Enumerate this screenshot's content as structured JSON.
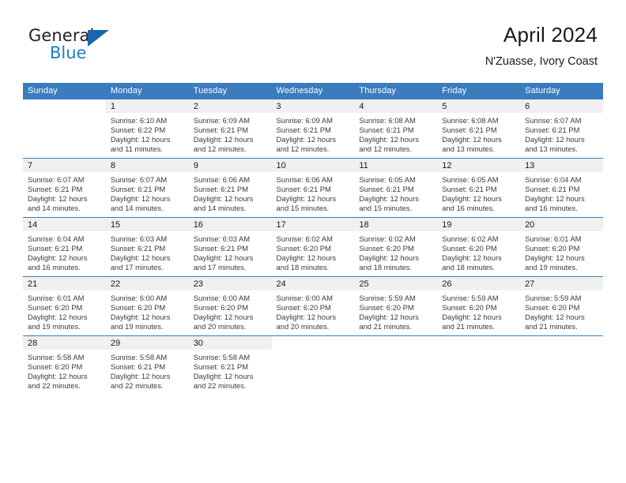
{
  "logo": {
    "word1": "General",
    "word2": "Blue",
    "triangle_color": "#1767ad",
    "blue_color": "#1b7dc4"
  },
  "title": {
    "month_year": "April 2024",
    "location": "N'Zuasse, Ivory Coast"
  },
  "theme": {
    "header_blue": "#3a7cbe",
    "daynum_gray": "#f0f0f0",
    "text": "#3b3b3b"
  },
  "calendar": {
    "weekday_headers": [
      "Sunday",
      "Monday",
      "Tuesday",
      "Wednesday",
      "Thursday",
      "Friday",
      "Saturday"
    ],
    "weeks": [
      [
        {
          "day": "",
          "sunrise": "",
          "sunset": "",
          "daylight1": "",
          "daylight2": "",
          "blank": true
        },
        {
          "day": "1",
          "sunrise": "Sunrise: 6:10 AM",
          "sunset": "Sunset: 6:22 PM",
          "daylight1": "Daylight: 12 hours",
          "daylight2": "and 11 minutes."
        },
        {
          "day": "2",
          "sunrise": "Sunrise: 6:09 AM",
          "sunset": "Sunset: 6:21 PM",
          "daylight1": "Daylight: 12 hours",
          "daylight2": "and 12 minutes."
        },
        {
          "day": "3",
          "sunrise": "Sunrise: 6:09 AM",
          "sunset": "Sunset: 6:21 PM",
          "daylight1": "Daylight: 12 hours",
          "daylight2": "and 12 minutes."
        },
        {
          "day": "4",
          "sunrise": "Sunrise: 6:08 AM",
          "sunset": "Sunset: 6:21 PM",
          "daylight1": "Daylight: 12 hours",
          "daylight2": "and 12 minutes."
        },
        {
          "day": "5",
          "sunrise": "Sunrise: 6:08 AM",
          "sunset": "Sunset: 6:21 PM",
          "daylight1": "Daylight: 12 hours",
          "daylight2": "and 13 minutes."
        },
        {
          "day": "6",
          "sunrise": "Sunrise: 6:07 AM",
          "sunset": "Sunset: 6:21 PM",
          "daylight1": "Daylight: 12 hours",
          "daylight2": "and 13 minutes."
        }
      ],
      [
        {
          "day": "7",
          "sunrise": "Sunrise: 6:07 AM",
          "sunset": "Sunset: 6:21 PM",
          "daylight1": "Daylight: 12 hours",
          "daylight2": "and 14 minutes."
        },
        {
          "day": "8",
          "sunrise": "Sunrise: 6:07 AM",
          "sunset": "Sunset: 6:21 PM",
          "daylight1": "Daylight: 12 hours",
          "daylight2": "and 14 minutes."
        },
        {
          "day": "9",
          "sunrise": "Sunrise: 6:06 AM",
          "sunset": "Sunset: 6:21 PM",
          "daylight1": "Daylight: 12 hours",
          "daylight2": "and 14 minutes."
        },
        {
          "day": "10",
          "sunrise": "Sunrise: 6:06 AM",
          "sunset": "Sunset: 6:21 PM",
          "daylight1": "Daylight: 12 hours",
          "daylight2": "and 15 minutes."
        },
        {
          "day": "11",
          "sunrise": "Sunrise: 6:05 AM",
          "sunset": "Sunset: 6:21 PM",
          "daylight1": "Daylight: 12 hours",
          "daylight2": "and 15 minutes."
        },
        {
          "day": "12",
          "sunrise": "Sunrise: 6:05 AM",
          "sunset": "Sunset: 6:21 PM",
          "daylight1": "Daylight: 12 hours",
          "daylight2": "and 16 minutes."
        },
        {
          "day": "13",
          "sunrise": "Sunrise: 6:04 AM",
          "sunset": "Sunset: 6:21 PM",
          "daylight1": "Daylight: 12 hours",
          "daylight2": "and 16 minutes."
        }
      ],
      [
        {
          "day": "14",
          "sunrise": "Sunrise: 6:04 AM",
          "sunset": "Sunset: 6:21 PM",
          "daylight1": "Daylight: 12 hours",
          "daylight2": "and 16 minutes."
        },
        {
          "day": "15",
          "sunrise": "Sunrise: 6:03 AM",
          "sunset": "Sunset: 6:21 PM",
          "daylight1": "Daylight: 12 hours",
          "daylight2": "and 17 minutes."
        },
        {
          "day": "16",
          "sunrise": "Sunrise: 6:03 AM",
          "sunset": "Sunset: 6:21 PM",
          "daylight1": "Daylight: 12 hours",
          "daylight2": "and 17 minutes."
        },
        {
          "day": "17",
          "sunrise": "Sunrise: 6:02 AM",
          "sunset": "Sunset: 6:20 PM",
          "daylight1": "Daylight: 12 hours",
          "daylight2": "and 18 minutes."
        },
        {
          "day": "18",
          "sunrise": "Sunrise: 6:02 AM",
          "sunset": "Sunset: 6:20 PM",
          "daylight1": "Daylight: 12 hours",
          "daylight2": "and 18 minutes."
        },
        {
          "day": "19",
          "sunrise": "Sunrise: 6:02 AM",
          "sunset": "Sunset: 6:20 PM",
          "daylight1": "Daylight: 12 hours",
          "daylight2": "and 18 minutes."
        },
        {
          "day": "20",
          "sunrise": "Sunrise: 6:01 AM",
          "sunset": "Sunset: 6:20 PM",
          "daylight1": "Daylight: 12 hours",
          "daylight2": "and 19 minutes."
        }
      ],
      [
        {
          "day": "21",
          "sunrise": "Sunrise: 6:01 AM",
          "sunset": "Sunset: 6:20 PM",
          "daylight1": "Daylight: 12 hours",
          "daylight2": "and 19 minutes."
        },
        {
          "day": "22",
          "sunrise": "Sunrise: 6:00 AM",
          "sunset": "Sunset: 6:20 PM",
          "daylight1": "Daylight: 12 hours",
          "daylight2": "and 19 minutes."
        },
        {
          "day": "23",
          "sunrise": "Sunrise: 6:00 AM",
          "sunset": "Sunset: 6:20 PM",
          "daylight1": "Daylight: 12 hours",
          "daylight2": "and 20 minutes."
        },
        {
          "day": "24",
          "sunrise": "Sunrise: 6:00 AM",
          "sunset": "Sunset: 6:20 PM",
          "daylight1": "Daylight: 12 hours",
          "daylight2": "and 20 minutes."
        },
        {
          "day": "25",
          "sunrise": "Sunrise: 5:59 AM",
          "sunset": "Sunset: 6:20 PM",
          "daylight1": "Daylight: 12 hours",
          "daylight2": "and 21 minutes."
        },
        {
          "day": "26",
          "sunrise": "Sunrise: 5:59 AM",
          "sunset": "Sunset: 6:20 PM",
          "daylight1": "Daylight: 12 hours",
          "daylight2": "and 21 minutes."
        },
        {
          "day": "27",
          "sunrise": "Sunrise: 5:59 AM",
          "sunset": "Sunset: 6:20 PM",
          "daylight1": "Daylight: 12 hours",
          "daylight2": "and 21 minutes."
        }
      ],
      [
        {
          "day": "28",
          "sunrise": "Sunrise: 5:58 AM",
          "sunset": "Sunset: 6:20 PM",
          "daylight1": "Daylight: 12 hours",
          "daylight2": "and 22 minutes."
        },
        {
          "day": "29",
          "sunrise": "Sunrise: 5:58 AM",
          "sunset": "Sunset: 6:21 PM",
          "daylight1": "Daylight: 12 hours",
          "daylight2": "and 22 minutes."
        },
        {
          "day": "30",
          "sunrise": "Sunrise: 5:58 AM",
          "sunset": "Sunset: 6:21 PM",
          "daylight1": "Daylight: 12 hours",
          "daylight2": "and 22 minutes."
        },
        {
          "day": "",
          "sunrise": "",
          "sunset": "",
          "daylight1": "",
          "daylight2": "",
          "blank": true
        },
        {
          "day": "",
          "sunrise": "",
          "sunset": "",
          "daylight1": "",
          "daylight2": "",
          "blank": true
        },
        {
          "day": "",
          "sunrise": "",
          "sunset": "",
          "daylight1": "",
          "daylight2": "",
          "blank": true
        },
        {
          "day": "",
          "sunrise": "",
          "sunset": "",
          "daylight1": "",
          "daylight2": "",
          "blank": true
        }
      ]
    ]
  }
}
